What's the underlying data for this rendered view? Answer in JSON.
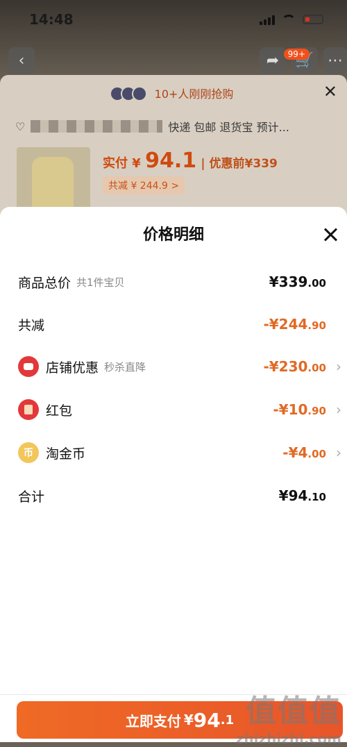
{
  "status_bar": {
    "time": "14:48"
  },
  "background": {
    "cart_badge": "99+",
    "buyers_text": "10+人刚刚抢购",
    "address_text": "快递 包邮 退货宝 预计...",
    "pay_label": "实付",
    "pay_currency": "¥",
    "pay_amount": "94.1",
    "original_label": "优惠前",
    "original_price": "¥339",
    "total_saved": "共减 ¥ 244.9 >"
  },
  "sheet": {
    "title": "价格明细",
    "rows": [
      {
        "label": "商品总价",
        "sub": "共1件宝贝",
        "currency": "¥",
        "amount_int": "339",
        "amount_dec": ".00",
        "negative": false
      },
      {
        "label": "共减",
        "sub": "",
        "currency": "-¥",
        "amount_int": "244",
        "amount_dec": ".90",
        "negative": true
      },
      {
        "label": "店铺优惠",
        "sub": "秒杀直降",
        "currency": "-¥",
        "amount_int": "230",
        "amount_dec": ".00",
        "negative": true,
        "icon": "shop-icon"
      },
      {
        "label": "红包",
        "sub": "",
        "currency": "-¥",
        "amount_int": "10",
        "amount_dec": ".90",
        "negative": true,
        "icon": "red-packet-icon"
      },
      {
        "label": "淘金币",
        "sub": "",
        "currency": "-¥",
        "amount_int": "4",
        "amount_dec": ".00",
        "negative": true,
        "icon": "coin-icon"
      },
      {
        "label": "合计",
        "sub": "",
        "currency": "¥",
        "amount_int": "94",
        "amount_dec": ".10",
        "negative": false
      }
    ]
  },
  "pay_button": {
    "label": "立即支付",
    "currency": "¥",
    "amount_int": "94",
    "amount_dec": ".1"
  },
  "watermark": {
    "cn": "值值值",
    "en": "zhizhizhi.com"
  },
  "colors": {
    "accent": "#e8552a",
    "discount": "#e06a24"
  }
}
